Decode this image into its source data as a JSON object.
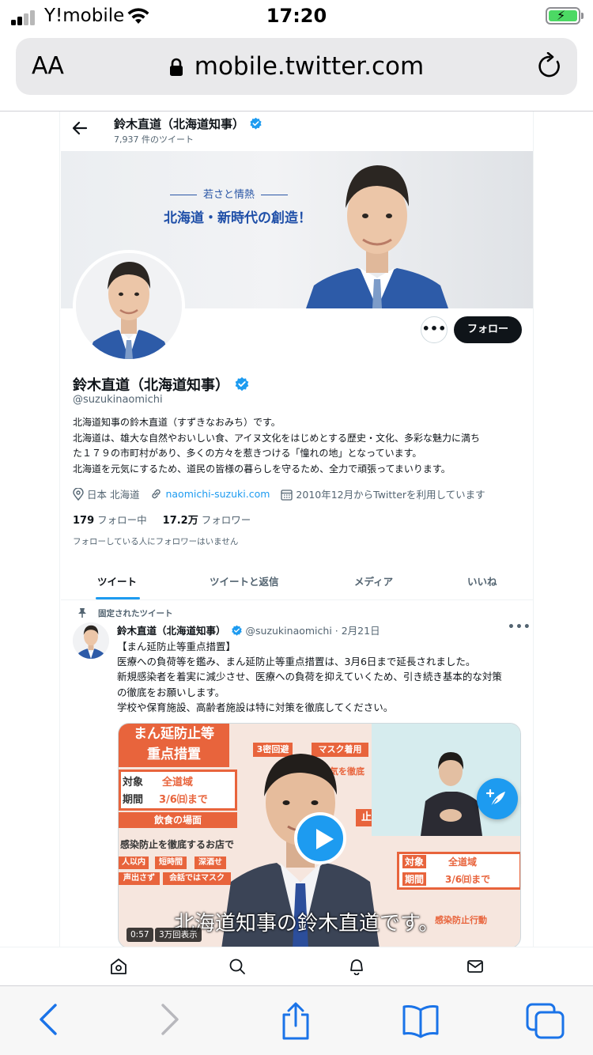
{
  "status_bar": {
    "carrier": "Y!mobile",
    "time": "17:20"
  },
  "address_bar": {
    "text_size_label": "AA",
    "url": "mobile.twitter.com"
  },
  "profile_nav": {
    "name": "鈴木直道（北海道知事）",
    "tweet_count": "7,937 件のツイート"
  },
  "banner": {
    "tagline": "若さと情熱",
    "slogan": "北海道・新時代の創造！"
  },
  "profile": {
    "name": "鈴木直道（北海道知事）",
    "handle": "@suzukinaomichi",
    "more_label": "•••",
    "follow_label": "フォロー",
    "bio": [
      "北海道知事の鈴木直道（すずきなおみち）です。",
      "北海道は、雄大な自然やおいしい食、アイヌ文化をはじめとする歴史・文化、多彩な魅力に満ち",
      "た１７９の市町村があり、多くの方々を惹きつける「憧れの地」となっています。",
      "北海道を元気にするため、道民の皆様の暮らしを守るため、全力で頑張ってまいります。"
    ],
    "location": "日本 北海道",
    "website": "naomichi-suzuki.com",
    "joined": "2010年12月からTwitterを利用しています",
    "following_count": "179",
    "following_label": "フォロー中",
    "followers_count": "17.2万",
    "followers_label": "フォロワー",
    "followers_note": "フォローしている人にフォロワーはいません"
  },
  "tabs": [
    {
      "label": "ツイート"
    },
    {
      "label": "ツイートと返信"
    },
    {
      "label": "メディア"
    },
    {
      "label": "いいね"
    }
  ],
  "tweet": {
    "pinned_label": "固定されたツイート",
    "author_name": "鈴木直道（北海道知事）",
    "author_handle_date": "@suzukinaomichi · 2月21日",
    "more_label": "•••",
    "lines": [
      "【まん延防止等重点措置】",
      "医療への負荷等を鑑み、まん延防止等重点措置は、3月6日まで延長されました。",
      "新規感染者を着実に減少させ、医療への負荷を抑えていくため、引き続き基本的な対策",
      "の徹底をお願いします。",
      "学校や保育施設、高齢者施設は特に対策を徹底してください。"
    ],
    "video": {
      "subtitle": "北海道知事の鈴木直道です。",
      "duration": "0:57",
      "views": "3万回表示",
      "poster_left": {
        "title_1": "まん延防止等",
        "title_2": "重点措置",
        "row1_label": "対象",
        "row1_value": "全道域",
        "row2_label": "期間",
        "row2_value": "3/6㈰まで",
        "section": "飲食の場面",
        "note": "感染防止を徹底するお店で",
        "chip1": "人以内",
        "chip2": "短時間",
        "chip3": "深酒せ",
        "chip4": "声出さず",
        "chip5": "会話ではマスク"
      },
      "poster_right": {
        "chip1": "3密回避",
        "chip2": "マスク着用",
        "chip3": "換気を徹底",
        "chip4": "止等",
        "row1_label": "対象",
        "row1_value": "全道域",
        "row2_label": "期間",
        "row2_value": "3/6㈰まで",
        "bottom": "感染防止行動"
      }
    }
  },
  "colors": {
    "accent": "#1d9bf0",
    "text": "#0f1419",
    "muted": "#536471",
    "poster_orange": "#e8643c"
  },
  "icons": {
    "bottom_nav": [
      "home-icon",
      "search-icon",
      "bell-icon",
      "mail-icon"
    ],
    "toolbar": [
      "back-arrow-icon",
      "forward-arrow-icon",
      "share-icon",
      "bookmarks-icon",
      "tabs-icon"
    ]
  }
}
